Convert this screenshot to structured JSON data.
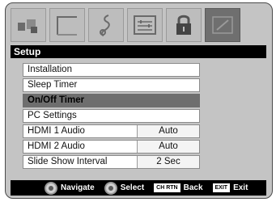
{
  "icons": [
    {
      "name": "picture-icon",
      "selected": false
    },
    {
      "name": "display-icon",
      "selected": false
    },
    {
      "name": "music-note-icon",
      "selected": false
    },
    {
      "name": "settings-panel-icon",
      "selected": false
    },
    {
      "name": "lock-icon",
      "selected": false
    },
    {
      "name": "setup-icon",
      "selected": true
    }
  ],
  "header": {
    "title": "Setup"
  },
  "menu": {
    "items": [
      {
        "label": "Installation",
        "value": ""
      },
      {
        "label": "Sleep Timer",
        "value": ""
      },
      {
        "label": "On/Off Timer",
        "value": "",
        "selected": true
      },
      {
        "label": "PC Settings",
        "value": ""
      },
      {
        "label": "HDMI 1 Audio",
        "value": "Auto"
      },
      {
        "label": "HDMI 2 Audio",
        "value": "Auto"
      },
      {
        "label": "Slide Show Interval",
        "value": "2 Sec"
      }
    ]
  },
  "footer": {
    "navigate_label": "Navigate",
    "select_label": "Select",
    "back_key": "CH RTN",
    "back_label": "Back",
    "exit_key": "EXIT",
    "exit_label": "Exit"
  }
}
